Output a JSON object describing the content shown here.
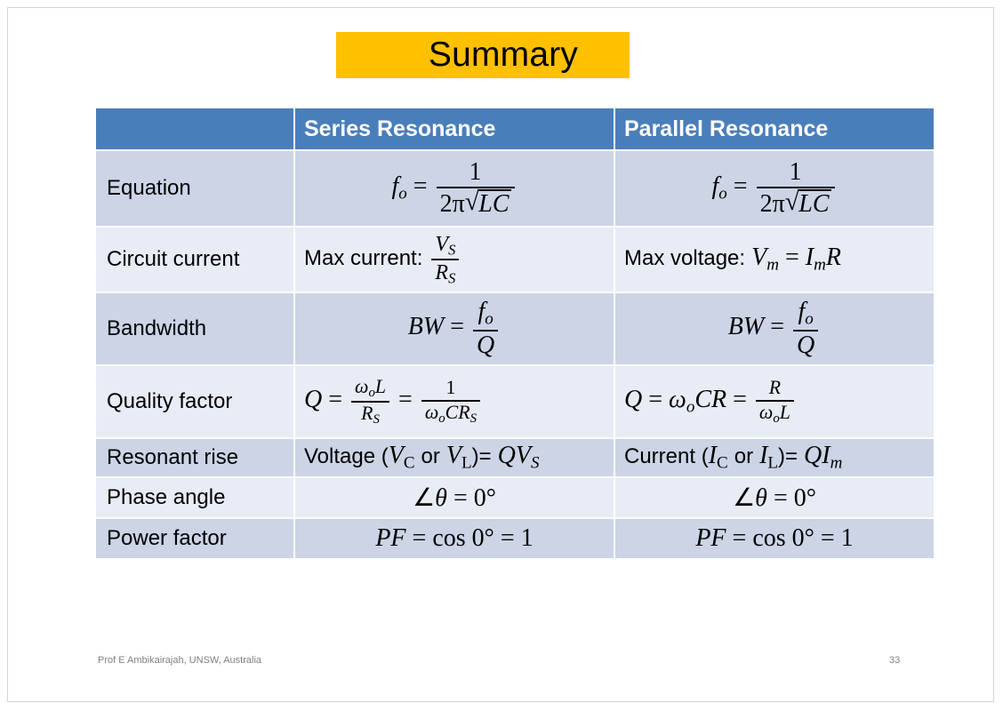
{
  "slide": {
    "title": "Summary",
    "title_band_color": "#ffc000",
    "header_color": "#4a7ebb",
    "row_color_odd": "#ccd4e6",
    "row_color_even": "#e8ecf5",
    "footer_author": "Prof  E  Ambikairajah, UNSW, Australia",
    "page_number": "33"
  },
  "table": {
    "columns": [
      "",
      "Series Resonance",
      "Parallel Resonance"
    ],
    "rows": [
      {
        "label": "Equation",
        "series": {
          "lhs": "f",
          "lhs_sub": "o",
          "eq": "=",
          "num": "1",
          "den_prefix": "2π",
          "den_radicand": "LC",
          "text": "f_o = 1 / (2π√(LC))"
        },
        "parallel": {
          "lhs": "f",
          "lhs_sub": "o",
          "eq": "=",
          "num": "1",
          "den_prefix": "2π",
          "den_radicand": "LC",
          "text": "f_o = 1 / (2π√(LC))"
        }
      },
      {
        "label": "Circuit current",
        "series": {
          "prefix": "Max current:",
          "num": "V",
          "num_sub": "S",
          "den": "R",
          "den_sub": "S",
          "text": "Max current: V_S / R_S"
        },
        "parallel": {
          "prefix": "Max voltage:",
          "lhs": "V",
          "lhs_sub": "m",
          "eq": "=",
          "rhs1": "I",
          "rhs1_sub": "m",
          "rhs2": "R",
          "text": "Max voltage: V_m = I_m R"
        }
      },
      {
        "label": "Bandwidth",
        "series": {
          "lhs": "BW",
          "eq": "=",
          "num": "f",
          "num_sub": "o",
          "den": "Q",
          "text": "BW = f_o / Q"
        },
        "parallel": {
          "lhs": "BW",
          "eq": "=",
          "num": "f",
          "num_sub": "o",
          "den": "Q",
          "text": "BW = f_o / Q"
        }
      },
      {
        "label": "Quality factor",
        "series": {
          "lhs": "Q",
          "eq1": "=",
          "f1_num_w": "ω",
          "f1_num_sub": "o",
          "f1_num_L": "L",
          "f1_den": "R",
          "f1_den_sub": "S",
          "eq2": "=",
          "f2_num": "1",
          "f2_den_w": "ω",
          "f2_den_sub": "o",
          "f2_den_rest": "CR",
          "f2_den_rest_sub": "S",
          "text": "Q = ω_o L / R_S = 1 / (ω_o C R_S)"
        },
        "parallel": {
          "lhs": "Q",
          "eq1": "=",
          "mid_w": "ω",
          "mid_sub": "o",
          "mid_rest": "CR",
          "eq2": "=",
          "f_num": "R",
          "f_den_w": "ω",
          "f_den_sub": "o",
          "f_den_rest": "L",
          "text": "Q = ω_o C R = R / (ω_o L)"
        }
      },
      {
        "label": "Resonant rise",
        "series": {
          "prefix": "Voltage (",
          "v1": "V",
          "v1_sub": "C",
          "conj": "or",
          "v2": "V",
          "v2_sub": "L",
          "eq": ")=",
          "rhs": "QV",
          "rhs_sub": "S",
          "text": "Voltage (V_C or V_L)= QV_S"
        },
        "parallel": {
          "prefix": "Current (",
          "v1": "I",
          "v1_sub": "C",
          "conj": "or",
          "v2": "I",
          "v2_sub": "L",
          "eq": ")=",
          "rhs": "QI",
          "rhs_sub": "m",
          "text": "Current (I_C or I_L)= QI_m"
        }
      },
      {
        "label": "Phase angle",
        "series": {
          "text": "∠θ = 0°",
          "angle": "∠",
          "theta": "θ",
          "eq": "=",
          "value": "0°"
        },
        "parallel": {
          "text": "∠θ = 0°",
          "angle": "∠",
          "theta": "θ",
          "eq": "=",
          "value": "0°"
        }
      },
      {
        "label": "Power factor",
        "series": {
          "text": "PF = cos 0° = 1",
          "lhs": "PF",
          "eq1": "=",
          "fn": "cos",
          "arg": "0°",
          "eq2": "=",
          "value": "1"
        },
        "parallel": {
          "text": "PF = cos 0° = 1",
          "lhs": "PF",
          "eq1": "=",
          "fn": "cos",
          "arg": "0°",
          "eq2": "=",
          "value": "1"
        }
      }
    ]
  }
}
